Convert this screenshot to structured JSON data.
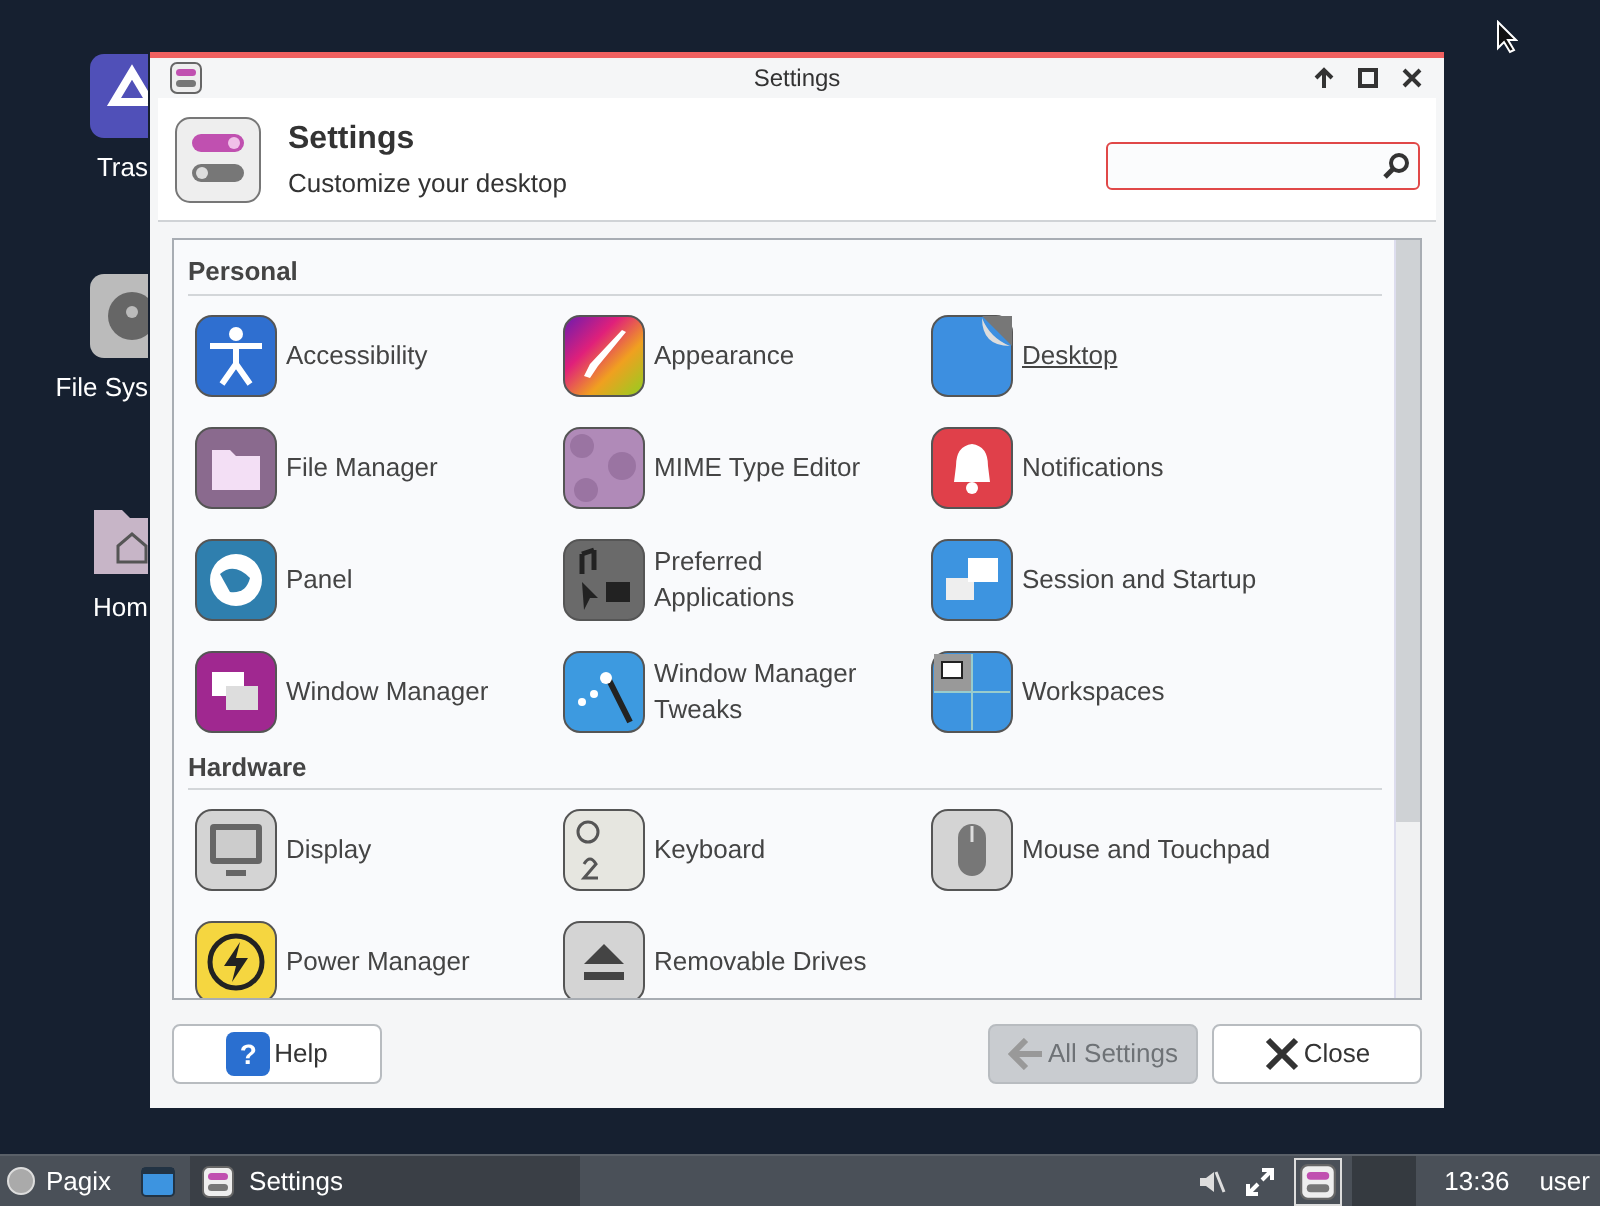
{
  "desktop_icons": [
    {
      "label": "Tras"
    },
    {
      "label": "File Sys"
    },
    {
      "label": "Hom"
    }
  ],
  "window": {
    "title": "Settings",
    "heading": "Settings",
    "subtitle": "Customize your desktop"
  },
  "sections": [
    {
      "title": "Personal",
      "items": [
        {
          "label": "Accessibility",
          "hovered": false
        },
        {
          "label": "Appearance",
          "hovered": false
        },
        {
          "label": "Desktop",
          "hovered": true
        },
        {
          "label": "File Manager",
          "hovered": false
        },
        {
          "label": "MIME Type Editor",
          "hovered": false
        },
        {
          "label": "Notifications",
          "hovered": false
        },
        {
          "label": "Panel",
          "hovered": false
        },
        {
          "label": "Preferred Applications",
          "hovered": false
        },
        {
          "label": "Session and Startup",
          "hovered": false
        },
        {
          "label": "Window Manager",
          "hovered": false
        },
        {
          "label": "Window Manager Tweaks",
          "hovered": false
        },
        {
          "label": "Workspaces",
          "hovered": false
        }
      ]
    },
    {
      "title": "Hardware",
      "items": [
        {
          "label": "Display",
          "hovered": false
        },
        {
          "label": "Keyboard",
          "hovered": false
        },
        {
          "label": "Mouse and Touchpad",
          "hovered": false
        },
        {
          "label": "Power Manager",
          "hovered": false
        },
        {
          "label": "Removable Drives",
          "hovered": false
        }
      ]
    }
  ],
  "buttons": [
    {
      "label": "Help",
      "icon_text": "?",
      "disabled": false
    },
    {
      "label": "All Settings",
      "disabled": true
    },
    {
      "label": "Close",
      "disabled": false
    }
  ],
  "taskbar": {
    "menu": "Pagix",
    "task": {
      "label": "Settings",
      "selected": true
    },
    "clock": "13:36",
    "user": "user"
  }
}
